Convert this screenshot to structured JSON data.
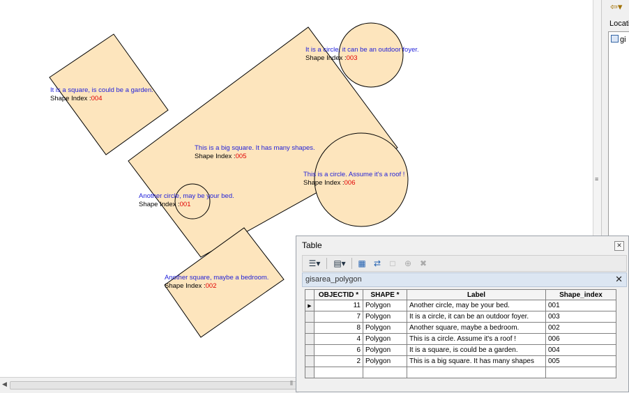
{
  "map": {
    "labels": [
      {
        "id": "003",
        "desc": "It is a circle, it can be an outdoor foyer.",
        "prefix": "Shape Index :",
        "index": "003"
      },
      {
        "id": "004",
        "desc": "It is a square, is could be a garden.",
        "prefix": "Shape Index :",
        "index": "004"
      },
      {
        "id": "005",
        "desc": "This  is a big square. It has many shapes.",
        "prefix": "Shape Index :",
        "index": "005"
      },
      {
        "id": "006",
        "desc": "This  is a circle. Assume it's  a roof !",
        "prefix": "Shape Index :",
        "index": "006"
      },
      {
        "id": "001",
        "desc": "Another circle, may be your bed.",
        "prefix": "Shape Index :",
        "index": "001"
      },
      {
        "id": "002",
        "desc": "Another square, maybe a bedroom.",
        "prefix": "Shape Index :",
        "index": "002"
      }
    ],
    "polygon_fill": "#fde5bd",
    "polygon_stroke": "#000000",
    "label_color": "#1f1fd9",
    "index_color": "#e00000"
  },
  "right_panel": {
    "back_icon": "back-arrow-icon",
    "location_label": "Locatio",
    "tree_item": "gi"
  },
  "table_window": {
    "title": "Table",
    "tab_name": "gisarea_polygon",
    "toolbar_icons": [
      "table-options-icon",
      "related-tables-icon",
      "select-by-attributes-icon",
      "switch-selection-icon",
      "clear-selection-icon",
      "zoom-to-selected-icon",
      "delete-selected-icon"
    ],
    "columns": [
      "OBJECTID *",
      "SHAPE *",
      "Label",
      "Shape_index"
    ],
    "rows": [
      {
        "objectid": "11",
        "shape": "Polygon",
        "label": "Another circle, may be your bed.",
        "shape_index": "001"
      },
      {
        "objectid": "7",
        "shape": "Polygon",
        "label": "It is a circle, it can be an outdoor foyer.",
        "shape_index": "003"
      },
      {
        "objectid": "8",
        "shape": "Polygon",
        "label": "Another square, maybe a bedroom.",
        "shape_index": "002"
      },
      {
        "objectid": "4",
        "shape": "Polygon",
        "label": "This is a circle. Assume it's a roof !",
        "shape_index": "006"
      },
      {
        "objectid": "6",
        "shape": "Polygon",
        "label": "It is a square, is could be a garden.",
        "shape_index": "004"
      },
      {
        "objectid": "2",
        "shape": "Polygon",
        "label": "This is a big square. It has many shapes",
        "shape_index": "005"
      }
    ]
  }
}
